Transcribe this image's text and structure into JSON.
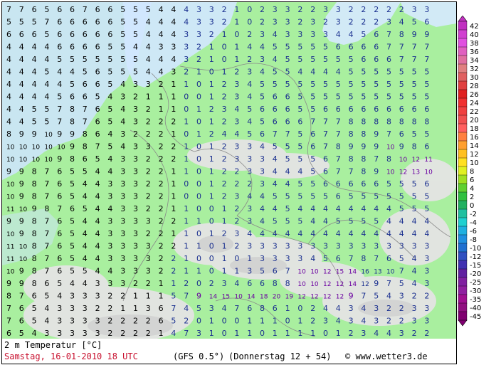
{
  "map": {
    "variable": "2 m Temperatur [°C]",
    "date_line": "Samstag, 16-01-2010   18 UTC",
    "model": "(GFS 0.5°)",
    "run": "(Donnerstag 12 + 54)",
    "credit": "© www.wetter3.de"
  },
  "legend": {
    "labels": [
      "42",
      "40",
      "38",
      "36",
      "34",
      "32",
      "30",
      "28",
      "26",
      "24",
      "22",
      "20",
      "18",
      "16",
      "14",
      "12",
      "10",
      "8",
      "6",
      "4",
      "2",
      "0",
      "-2",
      "-4",
      "-6",
      "-8",
      "-10",
      "-12",
      "-15",
      "-20",
      "-25",
      "-30",
      "-35",
      "-40",
      "-45"
    ],
    "colors": [
      "#c030c0",
      "#d040d0",
      "#e050e0",
      "#e060c0",
      "#e070a0",
      "#e08080",
      "#e06060",
      "#e04040",
      "#e02020",
      "#f03030",
      "#f04040",
      "#f05050",
      "#ff6060",
      "#ff8040",
      "#ffa030",
      "#ffc020",
      "#ffe020",
      "#e0f020",
      "#a0e020",
      "#60d030",
      "#30c040",
      "#20b060",
      "#20c0a0",
      "#20d0d0",
      "#20b0e0",
      "#2090e0",
      "#2070d0",
      "#3050c0",
      "#4030b0",
      "#6020a0",
      "#8020a0",
      "#9020a0",
      "#a01090",
      "#901080",
      "#800070"
    ]
  },
  "grid_rows": [
    "7 7 6 5 6 6 7 6 6 5 5 5 4 4 4 3 3 2 1 0 2 3 3 2 2 3 3 2 2 2 2 2 3 3",
    "5 5 5 7 6 6 6 6 6 5 5 4 4 4 4 3 3 2 1 0 2 3 3 2 3 2 3 2 2 2 3 4 5 6",
    "6 6 6 5 6 6 6 6 6 5 5 4 4 4 3 3 2 1 0 2 3 4 3 3 3 3 4 4 5 6 7 8 9 9",
    "4 4 4 4 6 6 6 6 5 5 4 4 3 3 3 2 1 0 1 4 4 5 5 5 5 5 6 6 6 6 7 7 7 7",
    "4 4 4 4 5 5 5 5 5 5 5 4 4 4 3 2 1 0 1 2 3 4 5 5 5 5 5 5 6 6 6 7 7 7",
    "4 4 4 5 4 4 5 6 5 5 5 4 4 3 2 1 0 1 2 3 4 5 5 4 4 4 4 5 5 5 5 5 5 5",
    "4 4 4 4 4 5 6 6 5 4 3 3 2 1 1 0 1 2 3 4 5 5 5 5 5 5 5 5 5 5 5 5 5 5",
    "4 4 4 4 5 6 6 5 4 3 2 1 1 1 0 0 1 2 3 4 5 6 6 5 5 5 5 5 5 5 5 5 5 5",
    "4 4 5 5 7 8 7 6 5 4 3 2 1 1 0 1 2 3 4 5 6 6 6 5 5 6 6 6 6 6 6 6 6 6",
    "4 4 5 5 7 8 7 6 5 4 3 2 2 2 1 0 1 2 3 4 5 6 6 6 7 7 7 8 8 8 8 8 8 8",
    "8 9 9 10 9 9 8 6 4 3 2 2 2 1 0 1 2 4 4 5 6 7 7 5 6 7 7 8 8 9 7 6 5 5",
    "10 10 10 10 10 9 8 7 5 4 3 3 2 2 1 0 1 2 3 3 4 5 5 5 6 7 8 9 9 9 10 9 8 6",
    "10 10 10 10 9 8 6 5 4 3 3 2 2 2 1 0 1 2 3 3 3 4 5 5 5 6 7 8 8 7 8 10 12 11",
    "9 9 8 7 6 5 5 4 4 3 3 2 2 1 1 0 1 2 2 3 3 4 4 4 5 6 7 7 8 9 10 12 13 10",
    "10 9 8 7 6 5 4 4 3 3 3 2 2 1 0 0 1 2 2 2 3 4 4 5 5 6 6 6 6 6 5 5 5 6",
    "10 9 8 7 6 5 4 4 3 3 3 2 2 1 0 0 1 2 3 4 4 5 5 5 5 5 6 5 5 5 5 5 5 5",
    "11 10 9 8 7 6 5 4 4 3 3 2 2 1 1 0 0 1 2 3 4 4 5 4 4 4 4 4 4 4 4 5 5 5",
    "9 9 8 7 6 5 4 4 3 3 3 3 2 2 1 1 0 1 2 3 4 5 5 5 4 4 5 5 5 5 4 4 4 4",
    "10 9 8 7 6 5 4 4 3 3 3 2 2 1 1 0 1 2 3 4 4 4 4 4 4 4 4 4 4 4 4 4 4 4",
    "11 10 8 7 6 5 4 4 3 3 3 3 2 2 1 1 0 1 2 3 3 3 3 3 3 3 3 3 3 3 3 3 3 3",
    "11 10 8 7 6 5 4 4 3 3 3 3 2 2 1 0 0 1 0 1 3 3 3 3 4 5 6 7 8 7 6 5 4 3",
    "10 9 8 7 6 5 5 4 4 3 3 3 2 2 1 1 0 1 1 3 5 6 7 10 10 12 15 14 16 13 10 7 4 3",
    "9 9 8 6 5 4 4 3 3 3 2 2 1 1 2 0 2 3 4 6 6 8 8 10 10 12 12 14 12 9 7 5 4 3",
    "8 7 6 5 4 3 3 3 2 2 1 1 1 5 7 9 14 15 10 14 18 20 19 12 12 12 12 9 7 5 4 3 2 2",
    "7 6 5 4 3 3 3 2 2 1 1 3 6 7 4 5 3 4 7 6 8 6 1 0 2 4 4 3 4 3 2 2 3 3",
    "7 6 5 4 3 3 3 3 2 2 2 2 6 5 2 0 1 0 0 1 1 1 0 1 2 3 4 3 4 3 2 2 3 3",
    "6 5 4 3 3 3 3 3 2 2 2 2 1 4 7 3 1 0 1 1 0 1 1 1 1 0 1 2 3 4 4 3 2 2"
  ],
  "show_labels": [
    "-45",
    "-40",
    "-35",
    "-30",
    "-25",
    "-20",
    "-15",
    "-12",
    "-10",
    "-8",
    "-6",
    "-4",
    "-2",
    "0",
    "2",
    "4",
    "6",
    "8",
    "10",
    "12",
    "14",
    "16",
    "18",
    "20",
    "22",
    "24",
    "26",
    "28",
    "30",
    "32",
    "34",
    "36",
    "38",
    "40",
    "42"
  ]
}
